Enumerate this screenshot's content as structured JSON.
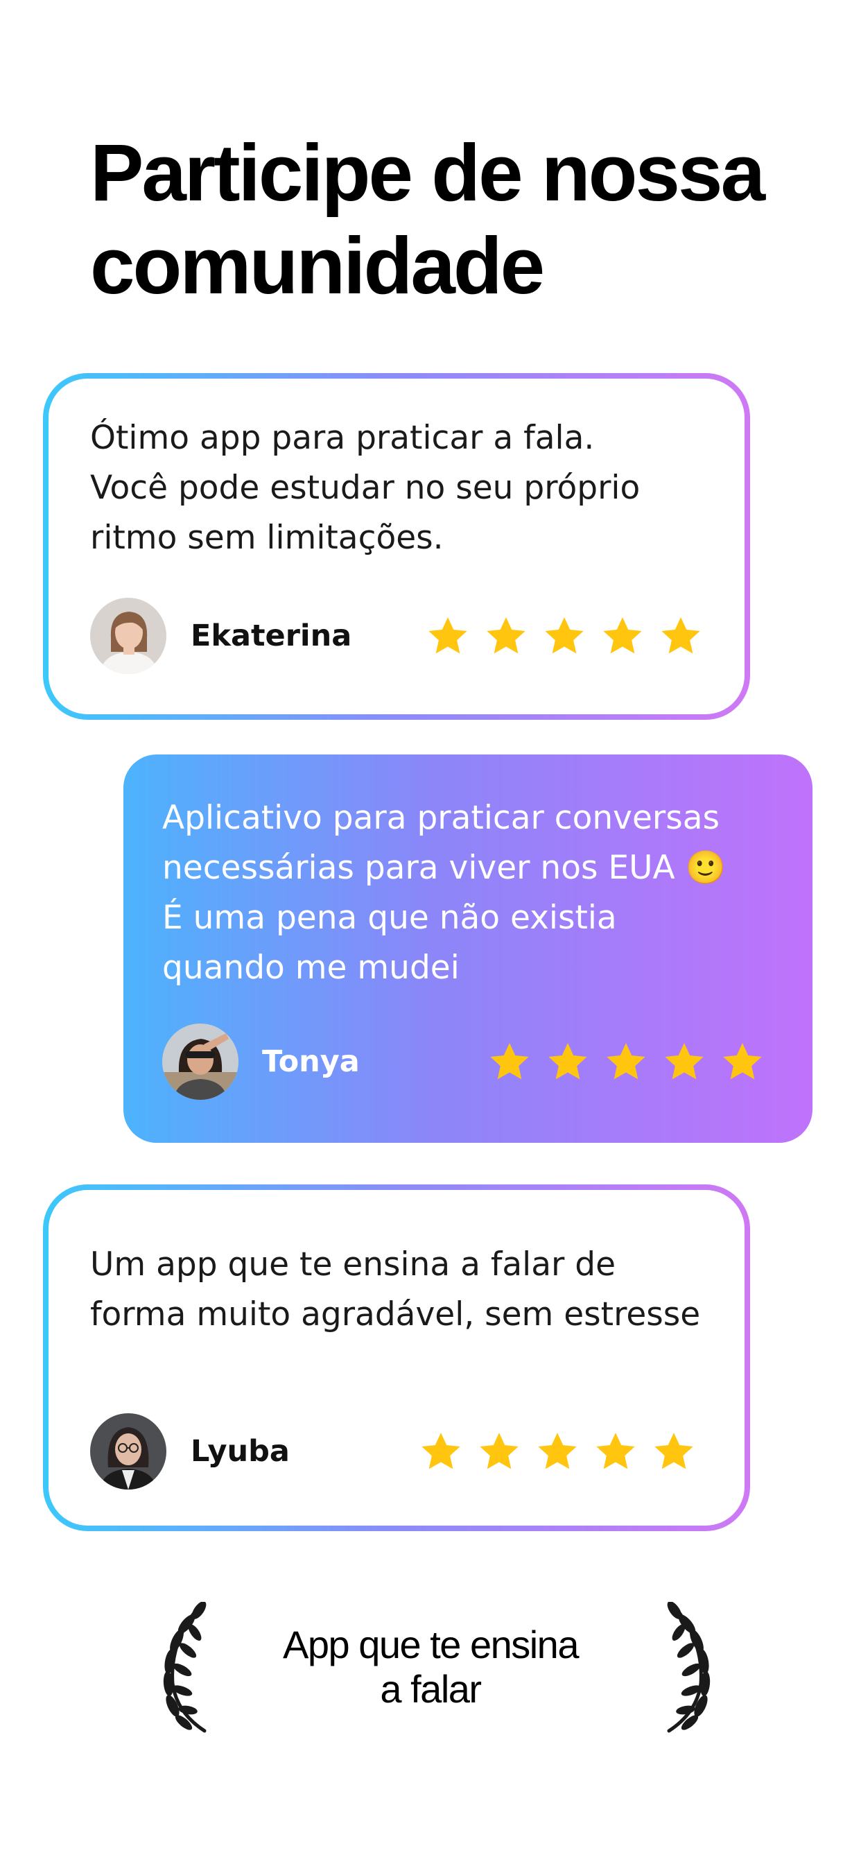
{
  "title": {
    "line1": "Participe de nossa",
    "line2": "comunidade"
  },
  "reviews": [
    {
      "text": "Ótimo app para praticar a fala.\nVocê pode estudar no seu próprio\nritmo sem limitações.",
      "author": "Ekaterina",
      "rating": 5,
      "style": "outline"
    },
    {
      "text": "Aplicativo para praticar conversas\nnecessárias para viver nos EUA 🙂\nÉ uma pena que não existia\nquando me mudei",
      "author": "Tonya",
      "rating": 5,
      "style": "filled"
    },
    {
      "text": "Um app que te ensina a falar de\nforma muito agradável, sem estresse",
      "author": "Lyuba",
      "rating": 5,
      "style": "outline"
    }
  ],
  "award": {
    "line1": "App que te ensina",
    "line2": "a falar",
    "icon": "laurel-wreath-icon"
  },
  "colors": {
    "star": "#ffc50f",
    "gradient_start": "#3cc8fb",
    "gradient_end": "#cf78f5"
  }
}
